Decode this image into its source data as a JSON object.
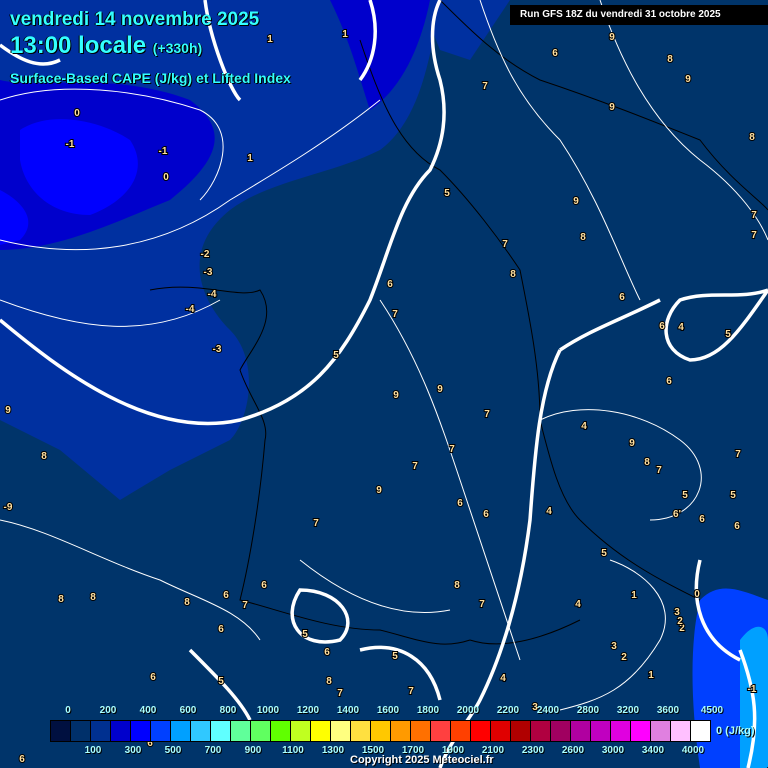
{
  "header": {
    "date": "vendredi 14 novembre 2025",
    "time": "13:00 locale",
    "lead": "(+330h)",
    "field": "Surface-Based CAPE (J/kg) et Lifted Index",
    "run": "Run GFS 18Z du vendredi 31 octobre 2025"
  },
  "legend": {
    "colors": [
      "#001040",
      "#00306a",
      "#003090",
      "#0000cc",
      "#0000ff",
      "#0040ff",
      "#00a0ff",
      "#30c8ff",
      "#60ffff",
      "#60ff9a",
      "#60ff60",
      "#60ff00",
      "#c0ff20",
      "#ffff00",
      "#ffff80",
      "#ffe040",
      "#ffc800",
      "#ff9a00",
      "#ff7000",
      "#ff4040",
      "#ff4000",
      "#ff0000",
      "#e00000",
      "#b00000",
      "#b00040",
      "#a00060",
      "#b000a0",
      "#c000c0",
      "#e000e0",
      "#ff00ff",
      "#e080e0",
      "#ffc0ff",
      "#ffffff"
    ],
    "top_ticks": [
      "0",
      "200",
      "400",
      "600",
      "800",
      "1000",
      "1200",
      "1400",
      "1600",
      "1800",
      "2000",
      "2200",
      "2400",
      "2800",
      "3200",
      "3600",
      "4500"
    ],
    "bottom_ticks": [
      "100",
      "300",
      "500",
      "700",
      "900",
      "1100",
      "1300",
      "1500",
      "1700",
      "1900",
      "2100",
      "2300",
      "2600",
      "3000",
      "3400",
      "4000"
    ],
    "unit": "0 (J/kg)"
  },
  "contour_labels": [
    "1",
    "1",
    "9",
    "6",
    "8",
    "9",
    "7",
    "9",
    "8",
    "0",
    "-1",
    "-1",
    "0",
    "1",
    "5",
    "9",
    "7",
    "7",
    "7",
    "8",
    "-2",
    "-3",
    "8",
    "6",
    "-4",
    "-4",
    "6",
    "7",
    "6",
    "4",
    "5",
    "-3",
    "5",
    "6",
    "9",
    "9",
    "9",
    "7",
    "4",
    "9",
    "7",
    "8",
    "7",
    "8",
    "7",
    "7",
    "9",
    "5",
    "5",
    "-9",
    "6",
    "6",
    "4",
    "6'",
    "6",
    "6",
    "7",
    "5",
    "6",
    "8",
    "6",
    "7",
    "8",
    "8",
    "8",
    "4",
    "7",
    "1",
    "3",
    "0",
    "2",
    "6",
    "5",
    "6",
    "3",
    "2",
    "5",
    "6",
    "5",
    "8",
    "7",
    "1",
    "4",
    "7",
    "-1",
    "6",
    "6",
    "2",
    "3",
    "1"
  ],
  "copyright": "Copyright 2025 Meteociel.fr"
}
